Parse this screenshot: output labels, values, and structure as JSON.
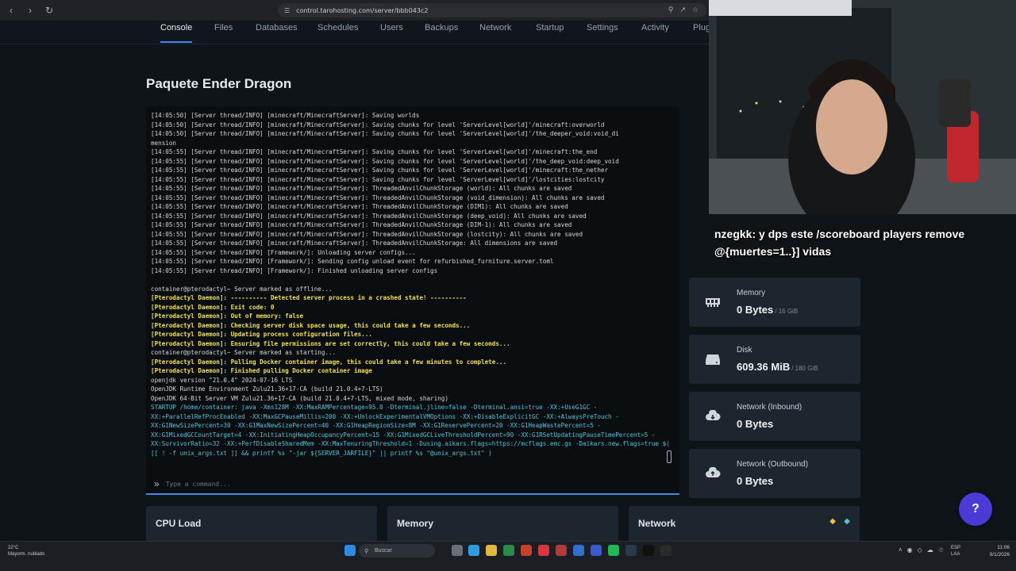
{
  "browser": {
    "url": "control.tarohosting.com/server/bbb043c2"
  },
  "tabs": [
    "Console",
    "Files",
    "Databases",
    "Schedules",
    "Users",
    "Backups",
    "Network",
    "Startup",
    "Settings",
    "Activity",
    "Plug"
  ],
  "page": {
    "title": "Paquete Ender Dragon"
  },
  "console": {
    "lines": [
      {
        "t": "[14:05:50] [Server thread/INFO] [minecraft/MinecraftServer]: Saving worlds",
        "c": ""
      },
      {
        "t": "[14:05:50] [Server thread/INFO] [minecraft/MinecraftServer]: Saving chunks for level 'ServerLevel[world]'/minecraft:overworld",
        "c": ""
      },
      {
        "t": "[14:05:50] [Server thread/INFO] [minecraft/MinecraftServer]: Saving chunks for level 'ServerLevel[world]'/the_deeper_void:void_di",
        "c": ""
      },
      {
        "t": "mension",
        "c": ""
      },
      {
        "t": "[14:05:55] [Server thread/INFO] [minecraft/MinecraftServer]: Saving chunks for level 'ServerLevel[world]'/minecraft:the_end",
        "c": ""
      },
      {
        "t": "[14:05:55] [Server thread/INFO] [minecraft/MinecraftServer]: Saving chunks for level 'ServerLevel[world]'/the_deep_void:deep_void",
        "c": ""
      },
      {
        "t": "[14:05:55] [Server thread/INFO] [minecraft/MinecraftServer]: Saving chunks for level 'ServerLevel[world]'/minecraft:the_nether",
        "c": ""
      },
      {
        "t": "[14:05:55] [Server thread/INFO] [minecraft/MinecraftServer]: Saving chunks for level 'ServerLevel[world]'/lostcities:lostcity",
        "c": ""
      },
      {
        "t": "[14:05:55] [Server thread/INFO] [minecraft/MinecraftServer]: ThreadedAnvilChunkStorage (world): All chunks are saved",
        "c": ""
      },
      {
        "t": "[14:05:55] [Server thread/INFO] [minecraft/MinecraftServer]: ThreadedAnvilChunkStorage (void_dimension): All chunks are saved",
        "c": ""
      },
      {
        "t": "[14:05:55] [Server thread/INFO] [minecraft/MinecraftServer]: ThreadedAnvilChunkStorage (DIM1): All chunks are saved",
        "c": ""
      },
      {
        "t": "[14:05:55] [Server thread/INFO] [minecraft/MinecraftServer]: ThreadedAnvilChunkStorage (deep_void): All chunks are saved",
        "c": ""
      },
      {
        "t": "[14:05:55] [Server thread/INFO] [minecraft/MinecraftServer]: ThreadedAnvilChunkStorage (DIM-1): All chunks are saved",
        "c": ""
      },
      {
        "t": "[14:05:55] [Server thread/INFO] [minecraft/MinecraftServer]: ThreadedAnvilChunkStorage (lostcity): All chunks are saved",
        "c": ""
      },
      {
        "t": "[14:05:55] [Server thread/INFO] [minecraft/MinecraftServer]: ThreadedAnvilChunkStorage: All dimensions are saved",
        "c": ""
      },
      {
        "t": "[14:05:55] [Server thread/INFO] [Framework/]: Unloading server configs...",
        "c": ""
      },
      {
        "t": "[14:05:55] [Server thread/INFO] [Framework/]: Sending config unload event for refurbished_furniture.server.toml",
        "c": ""
      },
      {
        "t": "[14:05:55] [Server thread/INFO] [Framework/]: Finished unloading server configs",
        "c": ""
      },
      {
        "t": " ",
        "c": ""
      },
      {
        "t": "container@pterodactyl~ Server marked as offline...",
        "c": ""
      },
      {
        "t": "[Pterodactyl Daemon]: ---------- Detected server process in a crashed state! ----------",
        "c": "yellow"
      },
      {
        "t": "[Pterodactyl Daemon]: Exit code: 0",
        "c": "yellow"
      },
      {
        "t": "[Pterodactyl Daemon]: Out of memory: false",
        "c": "yellow"
      },
      {
        "t": "[Pterodactyl Daemon]: Checking server disk space usage, this could take a few seconds...",
        "c": "yellow"
      },
      {
        "t": "[Pterodactyl Daemon]: Updating process configuration files...",
        "c": "yellow"
      },
      {
        "t": "[Pterodactyl Daemon]: Ensuring file permissions are set correctly, this could take a few seconds...",
        "c": "yellow"
      },
      {
        "t": "container@pterodactyl~ Server marked as starting...",
        "c": ""
      },
      {
        "t": "[Pterodactyl Daemon]: Pulling Docker container image, this could take a few minutes to complete...",
        "c": "yellow"
      },
      {
        "t": "[Pterodactyl Daemon]: Finished pulling Docker container image",
        "c": "yellow"
      },
      {
        "t": "openjdk version \"21.0.4\" 2024-07-16 LTS",
        "c": ""
      },
      {
        "t": "OpenJDK Runtime Environment Zulu21.36+17-CA (build 21.0.4+7-LTS)",
        "c": ""
      },
      {
        "t": "OpenJDK 64-Bit Server VM Zulu21.36+17-CA (build 21.0.4+7-LTS, mixed mode, sharing)",
        "c": ""
      }
    ],
    "startup": "STARTUP /home/container: java -Xms128M -XX:MaxRAMPercentage=95.0 -Dterminal.jline=false -Dterminal.ansi=true -XX:+UseG1GC -XX:+ParallelRefProcEnabled -XX:MaxGCPauseMillis=200 -XX:+UnlockExperimentalVMOptions -XX:+DisableExplicitGC -XX:+AlwaysPreTouch -XX:G1NewSizePercent=30 -XX:G1MaxNewSizePercent=40 -XX:G1HeapRegionSize=8M -XX:G1ReservePercent=20 -XX:G1HeapWastePercent=5 -XX:G1MixedGCCountTarget=4 -XX:InitiatingHeapOccupancyPercent=15 -XX:G1MixedGCLiveThresholdPercent=90 -XX:G1RSetUpdatingPauseTimePercent=5 -XX:SurvivorRatio=32 -XX:+PerfDisableSharedMem -XX:MaxTenuringThreshold=1 -Dusing.aikars.flags=https://mcflags.emc.gs -Daikars.new.flags=true $( [[ ! -f unix_args.txt ]] && printf %s \"-jar ${SERVER_JARFILE}\" || printf %s \"@unix_args.txt\" )",
    "placeholder": "Type a command..."
  },
  "stats": [
    {
      "label": "Memory",
      "value": "0 Bytes",
      "sub": "/ 16 GiB",
      "icon": "memory-icon"
    },
    {
      "label": "Disk",
      "value": "609.36 MiB",
      "sub": "/ 180 GiB",
      "icon": "disk-icon"
    },
    {
      "label": "Network (Inbound)",
      "value": "0 Bytes",
      "sub": "",
      "icon": "cloud-download-icon"
    },
    {
      "label": "Network (Outbound)",
      "value": "0 Bytes",
      "sub": "",
      "icon": "cloud-upload-icon"
    }
  ],
  "graphs": [
    "CPU Load",
    "Memory",
    "Network"
  ],
  "chat": {
    "user": "nzegkk",
    "message": ": y dps este /scoreboard players remove @{muertes=1..}] vidas"
  },
  "help": "?",
  "taskbar": {
    "weather_temp": "22°C",
    "weather_desc": "Mayorm. nublado",
    "search": "Buscar",
    "lang1": "ESP",
    "lang2": "LAA",
    "time": "11:06",
    "date": "9/1/2026"
  },
  "colors": {
    "accent": "#3a8cf0",
    "daemon": "#f0e04a",
    "startup": "#4fc4da",
    "card": "#1d262e"
  }
}
